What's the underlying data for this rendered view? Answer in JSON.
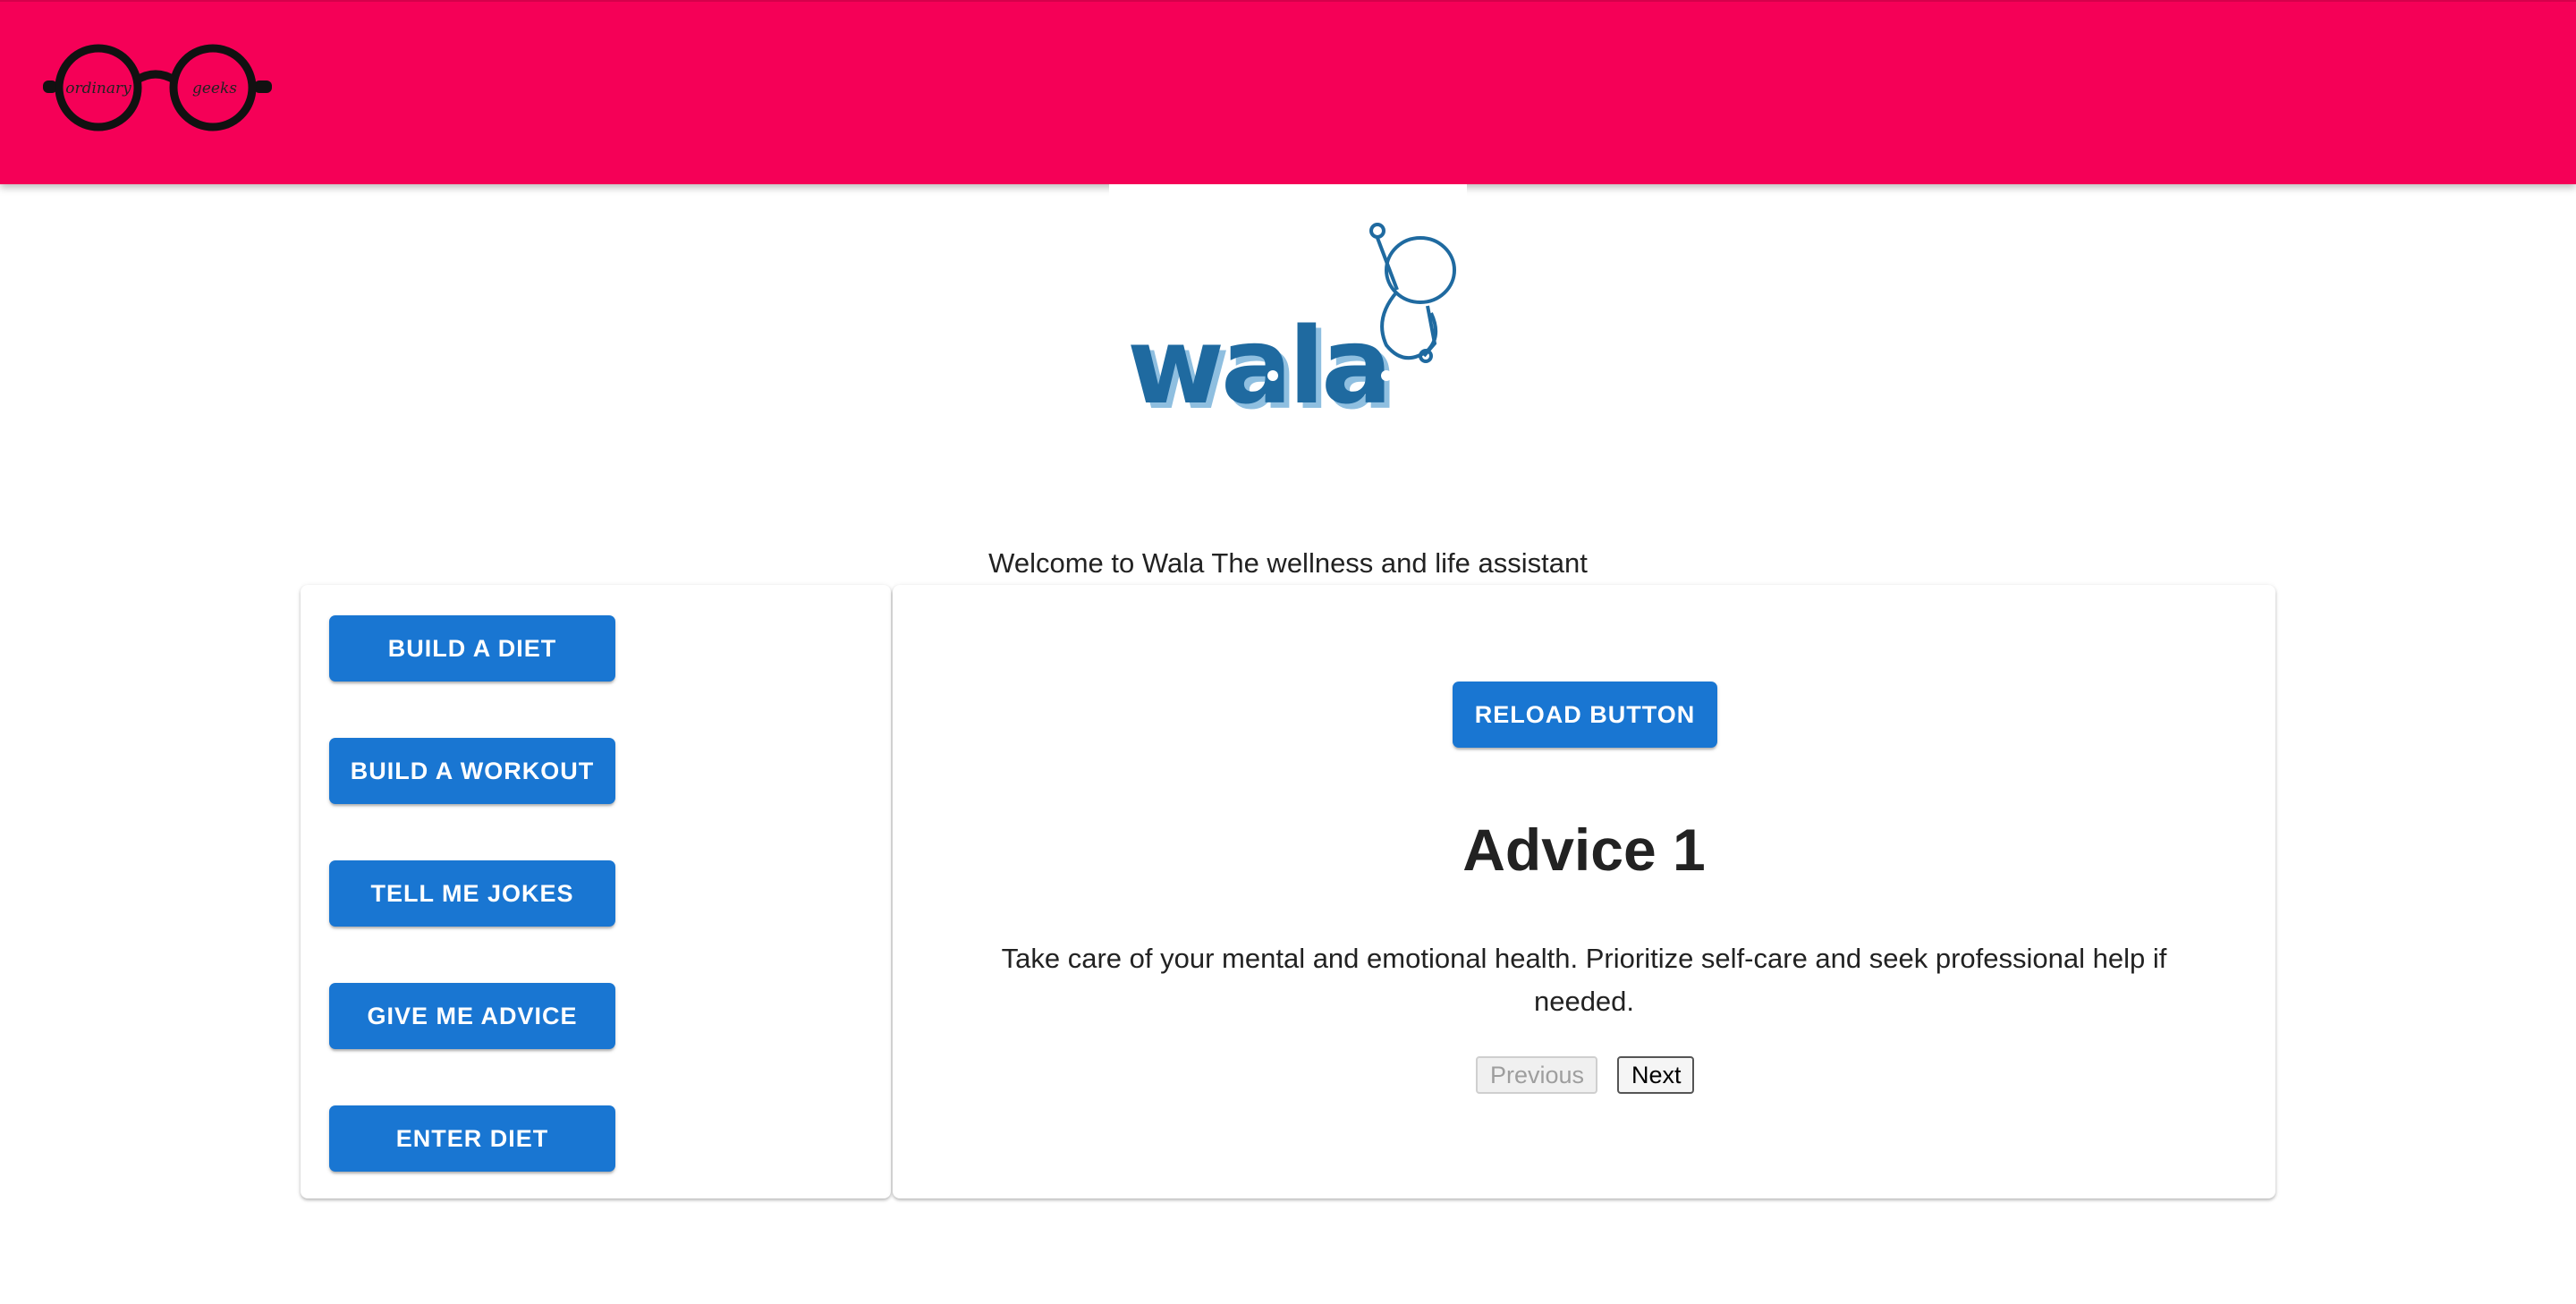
{
  "app": {
    "brand_left_lens": "ordinary",
    "brand_right_lens": "geeks",
    "logo_text": "wala",
    "accent_color": "#f50057",
    "button_color": "#1976d2",
    "logo_color": "#1f6aa0"
  },
  "welcome_text": "Welcome to Wala The wellness and life assistant",
  "sidebar": {
    "buttons": [
      {
        "label": "BUILD A DIET"
      },
      {
        "label": "BUILD A WORKOUT"
      },
      {
        "label": "TELL ME JOKES"
      },
      {
        "label": "GIVE ME ADVICE"
      },
      {
        "label": "ENTER DIET"
      }
    ]
  },
  "main": {
    "reload_label": "RELOAD BUTTON",
    "advice_title": "Advice 1",
    "advice_text": "Take care of your mental and emotional health. Prioritize self-care and seek professional help if needed.",
    "previous_label": "Previous",
    "next_label": "Next"
  }
}
